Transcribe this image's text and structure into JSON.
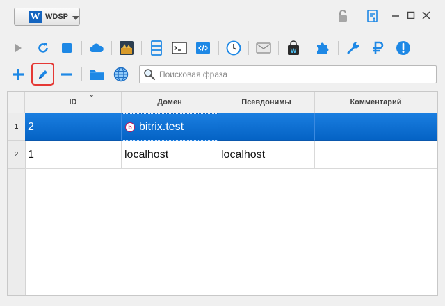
{
  "app": {
    "brand_letter": "W",
    "brand_name": "WDSP"
  },
  "search": {
    "placeholder": "Поисковая фраза"
  },
  "table": {
    "columns": [
      "ID",
      "Домен",
      "Псевдонимы",
      "Комментарий"
    ],
    "rows": [
      {
        "num": "1",
        "id": "2",
        "domain": "bitrix.test",
        "aliases": "",
        "comment": "",
        "selected": true
      },
      {
        "num": "2",
        "id": "1",
        "domain": "localhost",
        "aliases": "localhost",
        "comment": "",
        "selected": false
      }
    ]
  },
  "colors": {
    "accent": "#1565c0",
    "selection": "#0a6fd6",
    "highlight": "#e53935",
    "green": "#1e88e5"
  }
}
